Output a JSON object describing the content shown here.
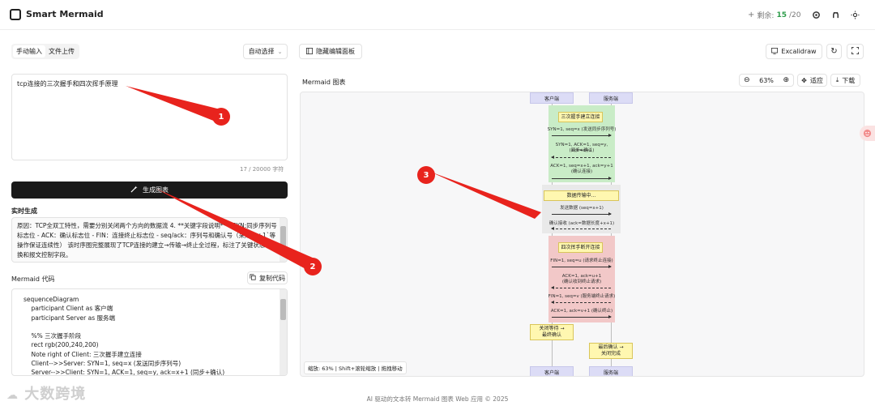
{
  "header": {
    "title": "Smart Mermaid",
    "quota_label": "剩余:",
    "quota_used": "15",
    "quota_total": "/20"
  },
  "input_tabs": [
    {
      "label": "手动输入",
      "active": true
    },
    {
      "label": "文件上传",
      "active": false
    }
  ],
  "auto_select_label": "自动选择",
  "toggle_panel_label": "隐藏编辑面板",
  "input": {
    "value": "tcp连接的三次握手和四次挥手原理",
    "counter": "17 / 20000 字符"
  },
  "generate_label": "生成图表",
  "realtime_label": "实时生成",
  "explanation": "原因：TCP全双工特性，需要分别关闭两个方向的数据流 4. **关键字段说明** - SYN:同步序列号标志位 - ACK：确认标志位 - FIN：连接终止标志位 - seq/ack：序列号和确认号（采用`x+1`等操作保证连续性） 该时序图完整展现了TCP连接的建立→传输→终止全过程，标注了关键状态转换和报文控制字段。",
  "code_section": {
    "label": "Mermaid 代码",
    "copy_label": "复制代码",
    "lines": [
      "sequenceDiagram",
      "    participant Client as 客户端",
      "    participant Server as 服务端",
      "",
      "    %% 三次握手阶段",
      "    rect rgb(200,240,200)",
      "    Note right of Client: 三次握手建立连接",
      "    Client-->>Server: SYN=1, seq=x (发送同步序列号)",
      "    Server-->>Client: SYN=1, ACK=1, seq=y, ack=x+1 (同步+确认)"
    ]
  },
  "preview": {
    "label": "Mermaid 图表",
    "excalidraw_label": "Excalidraw",
    "zoom_level": "63%",
    "fit_label": "适应",
    "download_label": "下载",
    "zoom_badge": "缩放: 63% | Shift+滚轮缩放 | 拖拽移动"
  },
  "diagram": {
    "client_label": "客户端",
    "server_label": "服务端",
    "handshake_note": "三次握手建立连接",
    "handshake_msgs": [
      "SYN=1, seq=x (发送同步序列号)",
      "SYN=1, ACK=1, seq=y, ack=x+1",
      "(同步+确认)",
      "ACK=1, seq=x+1, ack=y+1",
      "(确认连接)"
    ],
    "transfer_note": "数据传输中...",
    "transfer_msgs": [
      "发送数据 (seq=x+1)",
      "确认接收 (ack=数据长度+x+1)"
    ],
    "wave_note": "四次挥手断开连接",
    "wave_msgs": [
      "FIN=1, seq=u (请求终止连接)",
      "ACK=1, ack=u+1",
      "(确认收到终止请求)",
      "FIN=1, seq=v (服务端终止请求)",
      "ACK=1, ack=v+1 (确认终止)"
    ],
    "client_wait_note": [
      "关闭等待 →",
      "最终确认"
    ],
    "server_close_note": [
      "最后确认 →",
      "关闭完成"
    ]
  },
  "callouts": [
    "1",
    "2",
    "3"
  ],
  "footer": "AI 驱动的文本转 Mermaid 图表 Web 应用 © 2025",
  "watermark": "大数跨境",
  "colors": {
    "handshake_bg": "#c9ecc7",
    "transfer_bg": "#e9e9e9",
    "wave_bg": "#f2c8c8",
    "note_bg": "#fff7b0",
    "callout": "#e8231d",
    "accent_green": "#2e9d4b"
  }
}
